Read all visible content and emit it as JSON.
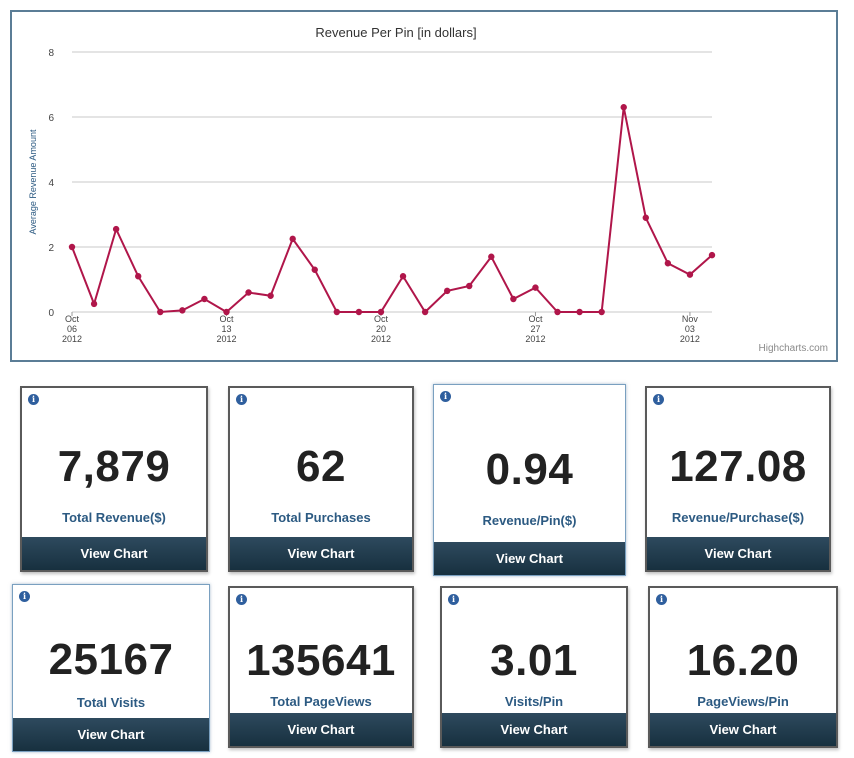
{
  "chart_data": {
    "type": "line",
    "title": "Revenue Per Pin [in dollars]",
    "ylabel": "Average Revenue Amount",
    "xlabel": "",
    "ylim": [
      0,
      8
    ],
    "yticks": [
      0,
      2,
      4,
      6,
      8
    ],
    "x_start": "2012-10-06",
    "xtick_labels": [
      {
        "lines": [
          "Oct",
          "06",
          "2012"
        ],
        "day_index": 0
      },
      {
        "lines": [
          "Oct",
          "13",
          "2012"
        ],
        "day_index": 7
      },
      {
        "lines": [
          "Oct",
          "20",
          "2012"
        ],
        "day_index": 14
      },
      {
        "lines": [
          "Oct",
          "27",
          "2012"
        ],
        "day_index": 21
      },
      {
        "lines": [
          "Nov",
          "03",
          "2012"
        ],
        "day_index": 28
      }
    ],
    "series": [
      {
        "color": "#b0164a",
        "values": [
          2.0,
          0.25,
          2.55,
          1.1,
          0.0,
          0.05,
          0.4,
          0.0,
          0.6,
          0.5,
          2.25,
          1.3,
          0.0,
          0.0,
          0.0,
          1.1,
          0.0,
          0.65,
          0.8,
          1.7,
          0.4,
          0.75,
          0.0,
          0.0,
          0.0,
          6.3,
          2.9,
          1.5,
          1.15,
          1.75
        ]
      }
    ],
    "grid": true,
    "credit": "Highcharts.com"
  },
  "cards": [
    {
      "value": "7,879",
      "label": "Total Revenue($)",
      "button": "View Chart"
    },
    {
      "value": "62",
      "label": "Total Purchases",
      "button": "View Chart"
    },
    {
      "value": "0.94",
      "label": "Revenue/Pin($)",
      "button": "View Chart"
    },
    {
      "value": "127.08",
      "label": "Revenue/Purchase($)",
      "button": "View Chart"
    },
    {
      "value": "25167",
      "label": "Total Visits",
      "button": "View Chart"
    },
    {
      "value": "135641",
      "label": "Total PageViews",
      "button": "View Chart"
    },
    {
      "value": "3.01",
      "label": "Visits/Pin",
      "button": "View Chart"
    },
    {
      "value": "16.20",
      "label": "PageViews/Pin",
      "button": "View Chart"
    }
  ],
  "info_icon": "info-icon",
  "colors": {
    "line": "#b0164a",
    "button": "#1f3a4d",
    "label": "#2c5a82",
    "value": "#222222"
  }
}
